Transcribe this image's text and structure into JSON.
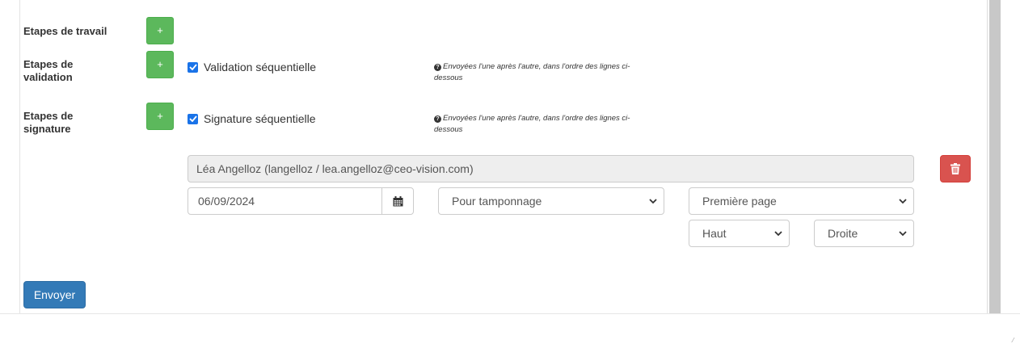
{
  "workflow": {
    "work_steps": {
      "label": "Etapes de travail",
      "add": "+"
    },
    "validation_steps": {
      "label": "Etapes de validation",
      "add": "+",
      "checkbox_label": "Validation séquentielle",
      "checked": true,
      "help": "Envoyées l'une après l'autre, dans l'ordre des lignes ci-dessous"
    },
    "signature_steps": {
      "label": "Etapes de signature",
      "add": "+",
      "checkbox_label": "Signature séquentielle",
      "checked": true,
      "help": "Envoyées l'une après l'autre, dans l'ordre des lignes ci-dessous"
    }
  },
  "signer": {
    "name": "Léa Angelloz (langelloz / lea.angelloz@ceo-vision.com)",
    "date": "06/09/2024",
    "type": "Pour tamponnage",
    "page": "Première page",
    "vertical": "Haut",
    "horizontal": "Droite"
  },
  "actions": {
    "send": "Envoyer"
  },
  "colors": {
    "success": "#5cb85c",
    "danger": "#d9534f",
    "primary": "#337ab7",
    "checkbox": "#1a73e8"
  },
  "icons": {
    "date": "calendar-icon",
    "delete": "trash-icon",
    "help": "question-circle-icon",
    "select": "chevron-down-icon"
  }
}
